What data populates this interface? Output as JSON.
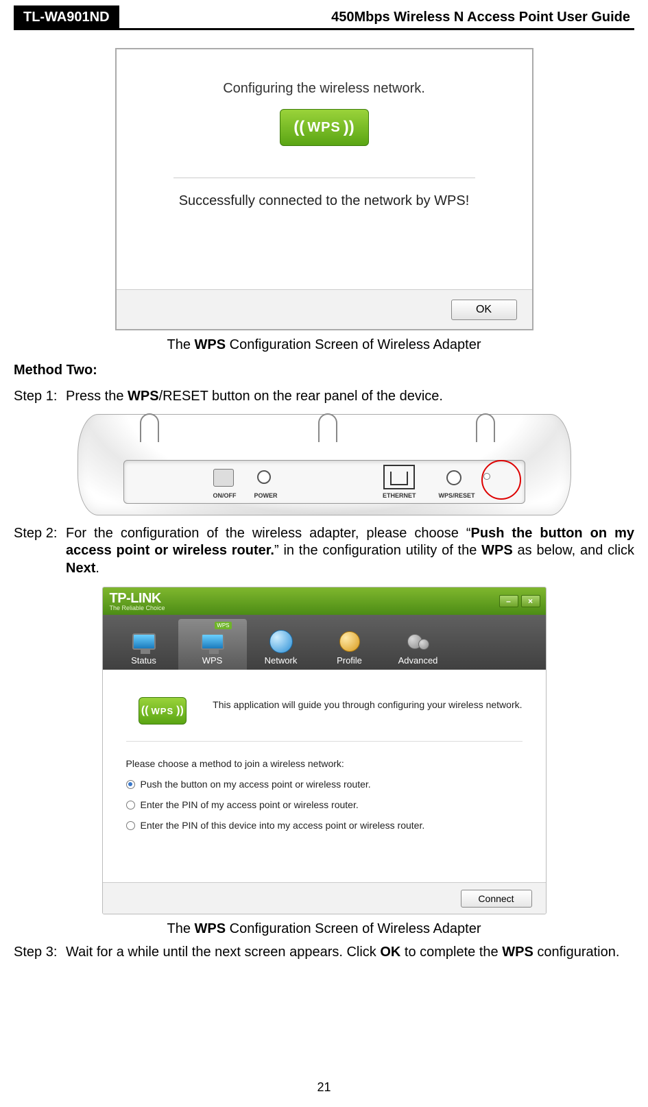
{
  "header": {
    "model": "TL-WA901ND",
    "title": "450Mbps Wireless N Access Point User Guide"
  },
  "page_number": "21",
  "dialog1": {
    "line1": "Configuring the wireless network.",
    "badge_text": "WPS",
    "success": "Successfully connected to the network by WPS!",
    "ok": "OK"
  },
  "caption1_pre": "The ",
  "caption1_b": "WPS",
  "caption1_post": " Configuration Screen of Wireless Adapter",
  "method_two": "Method Two:",
  "step1": {
    "label": "Step 1:",
    "t1": "Press the ",
    "b1": "WPS",
    "t2": "/RESET button on the rear panel of the device."
  },
  "rear_labels": {
    "onoff": "ON/OFF",
    "power": "POWER",
    "eth": "ETHERNET",
    "wps": "WPS/RESET"
  },
  "step2": {
    "label": "Step 2:",
    "t1": "For the configuration of the wireless adapter, please choose “",
    "b1": "Push the button on my access point or wireless router.",
    "t2": "” in the configuration utility of the ",
    "b2": "WPS",
    "t3": " as below, and click ",
    "b3": "Next",
    "t4": "."
  },
  "util": {
    "brand": "TP-LINK",
    "tagline": "The Reliable Choice",
    "tabs": {
      "status": "Status",
      "wps": "WPS",
      "wps_badge": "WPS",
      "network": "Network",
      "profile": "Profile",
      "advanced": "Advanced"
    },
    "intro_badge": "WPS",
    "intro": "This application will guide you through configuring your wireless network.",
    "choose": "Please choose a method to join a wireless network:",
    "opt1": "Push the button on my access point or wireless router.",
    "opt2": "Enter the PIN of my access point or wireless router.",
    "opt3": "Enter the PIN of this device into my access point or wireless router.",
    "connect": "Connect"
  },
  "caption2_pre": "The ",
  "caption2_b": "WPS",
  "caption2_post": " Configuration Screen of Wireless Adapter",
  "step3": {
    "label": "Step 3:",
    "t1": "Wait for a while until the next screen appears. Click ",
    "b1": "OK",
    "t2": " to complete the ",
    "b2": "WPS",
    "t3": " configuration."
  }
}
